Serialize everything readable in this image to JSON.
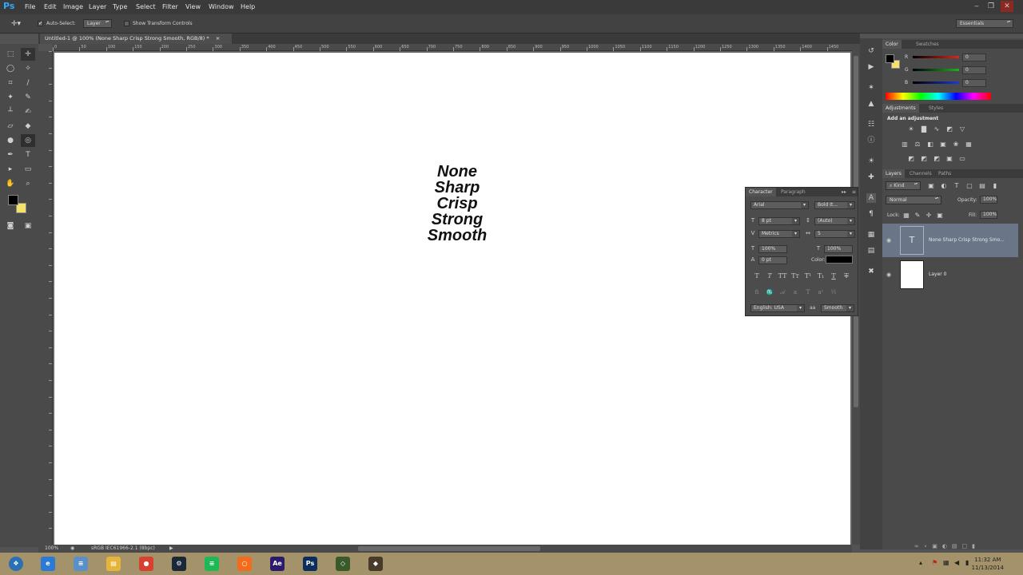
{
  "app": {
    "logo": "Ps"
  },
  "menu": [
    "File",
    "Edit",
    "Image",
    "Layer",
    "Type",
    "Select",
    "Filter",
    "View",
    "Window",
    "Help"
  ],
  "window_controls": {
    "minimize": "‒",
    "restore": "❐",
    "close": "✕"
  },
  "options_bar": {
    "auto_select_label": "Auto-Select:",
    "auto_select_checked": true,
    "auto_select_target": "Layer",
    "show_transform_label": "Show Transform Controls",
    "show_transform_checked": false,
    "workspace": "Essentials"
  },
  "document": {
    "tab_title": "Untitled-1 @ 100% (None Sharp Crisp Strong Smooth, RGB/8) *",
    "close_glyph": "×",
    "zoom": "100%",
    "color_profile": "sRGB IEC61966-2.1 (8bpc)",
    "text_lines": [
      "None",
      "Sharp",
      "Crisp",
      "Strong",
      "Smooth"
    ]
  },
  "ruler": {
    "h_ticks": [
      "0",
      "50",
      "100",
      "150",
      "200",
      "250",
      "300",
      "350",
      "400",
      "450",
      "500",
      "550",
      "600",
      "650",
      "700",
      "750",
      "800",
      "850",
      "900",
      "950",
      "1000",
      "1050",
      "1100",
      "1150",
      "1200",
      "1250",
      "1300",
      "1350",
      "1400",
      "1450"
    ]
  },
  "color_panel": {
    "tabs": [
      "Color",
      "Swatches"
    ],
    "channels": [
      {
        "label": "R",
        "value": "0",
        "color": "#e0261b"
      },
      {
        "label": "G",
        "value": "0",
        "color": "#22b022"
      },
      {
        "label": "B",
        "value": "0",
        "color": "#1e39d6"
      }
    ],
    "foreground": "#000000",
    "background": "#f5e26a"
  },
  "adjustments_panel": {
    "tabs": [
      "Adjustments",
      "Styles"
    ],
    "header": "Add an adjustment"
  },
  "layers_panel": {
    "tabs": [
      "Layers",
      "Channels",
      "Paths"
    ],
    "filter_kind": "Kind",
    "blend_mode": "Normal",
    "opacity_label": "Opacity:",
    "opacity": "100%",
    "lock_label": "Lock:",
    "fill_label": "Fill:",
    "fill": "100%",
    "layers": [
      {
        "name": "None Sharp Crisp Strong Smo...",
        "thumb": "T",
        "selected": true
      },
      {
        "name": "Layer 0",
        "thumb": "",
        "selected": false
      }
    ]
  },
  "character_panel": {
    "tabs": [
      "Character",
      "Paragraph"
    ],
    "font_family": "Arial",
    "font_style": "Bold It...",
    "font_size": "8 pt",
    "leading": "(Auto)",
    "kerning": "Metrics",
    "tracking": "5",
    "vertical_scale": "100%",
    "horizontal_scale": "100%",
    "baseline_shift": "0 pt",
    "color_label": "Color:",
    "text_color": "#000000",
    "language": "English: USA",
    "aa_label": "aa",
    "antialias": "Smooth"
  },
  "taskbar": {
    "time": "11:32 AM",
    "date": "11/13/2014",
    "apps": [
      {
        "id": "ie",
        "label": "e",
        "color": "#2b7bd6"
      },
      {
        "id": "notepad",
        "label": "≡",
        "color": "#5b8fc9"
      },
      {
        "id": "explorer",
        "label": "▤",
        "color": "#e6b43a"
      },
      {
        "id": "chrome",
        "label": "●",
        "color": "#d8412f"
      },
      {
        "id": "steam",
        "label": "⚙",
        "color": "#1b2838"
      },
      {
        "id": "spotify",
        "label": "≡",
        "color": "#1db954"
      },
      {
        "id": "origin",
        "label": "○",
        "color": "#f26c1c"
      },
      {
        "id": "aftereffects",
        "label": "Ae",
        "color": "#2c1a6b"
      },
      {
        "id": "photoshop",
        "label": "Ps",
        "color": "#0b2e5c"
      },
      {
        "id": "app9",
        "label": "◇",
        "color": "#3a5a2a"
      },
      {
        "id": "app10",
        "label": "◆",
        "color": "#4a3a2a"
      }
    ]
  }
}
